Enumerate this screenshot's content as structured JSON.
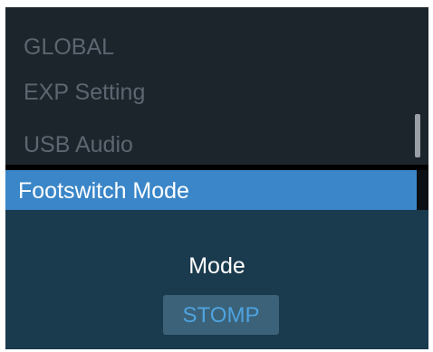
{
  "menu": {
    "items": [
      {
        "label": "GLOBAL"
      },
      {
        "label": "EXP Setting"
      },
      {
        "label": "USB Audio"
      }
    ],
    "selected": {
      "label": "Footswitch Mode"
    }
  },
  "panel": {
    "title": "Mode",
    "value": "STOMP"
  },
  "colors": {
    "background": "#1d252c",
    "dim_text": "#5c6670",
    "selected_bar": "#3a86c8",
    "panel_bg": "#1a3a4d",
    "value_box": "#3b6278",
    "value_text": "#4fa3e0"
  }
}
